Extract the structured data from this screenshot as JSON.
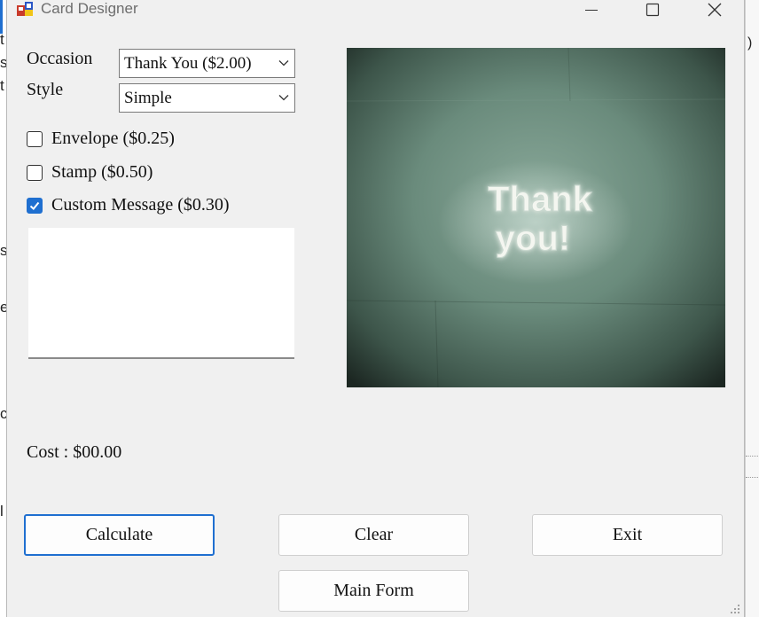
{
  "window": {
    "title": "Card Designer",
    "icon": "app-icon"
  },
  "background_fragments": {
    "left_chars": [
      "t",
      "s",
      "t",
      "s",
      "e",
      "c",
      "l"
    ],
    "right_char": ")"
  },
  "form": {
    "occasion_label": "Occasion",
    "style_label": "Style",
    "occasion_value": "Thank You ($2.00)",
    "style_value": "Simple",
    "envelope_label": "Envelope ($0.25)",
    "envelope_checked": false,
    "stamp_label": "Stamp ($0.50)",
    "stamp_checked": false,
    "custom_message_label": "Custom Message ($0.30)",
    "custom_message_checked": true,
    "custom_message_text": "",
    "cost_text": "Cost : $00.00"
  },
  "preview": {
    "line1": "Thank",
    "line2": "you!"
  },
  "buttons": {
    "calculate": "Calculate",
    "clear": "Clear",
    "exit": "Exit",
    "main_form": "Main Form"
  },
  "colors": {
    "accent": "#1f6fd0",
    "window_bg": "#f0f0f0",
    "card_bg": "#5f7f70"
  }
}
